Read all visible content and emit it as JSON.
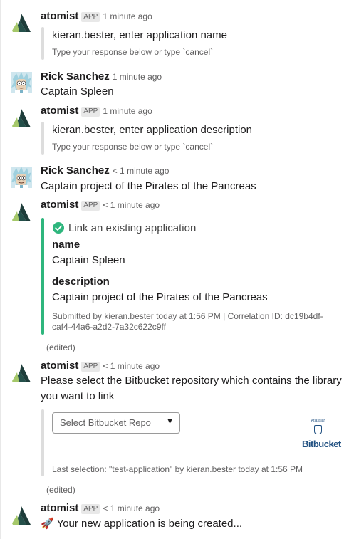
{
  "messages": [
    {
      "sender": "atomist",
      "badge": "APP",
      "time": "1 minute ago",
      "attachment": {
        "title": "kieran.bester, enter application name",
        "footer": "Type your response below or type `cancel`"
      }
    },
    {
      "sender": "Rick Sanchez",
      "time": "1 minute ago",
      "text": "Captain Spleen"
    },
    {
      "sender": "atomist",
      "badge": "APP",
      "time": "1 minute ago",
      "attachment": {
        "title": "kieran.bester, enter application description",
        "footer": "Type your response below or type `cancel`"
      }
    },
    {
      "sender": "Rick Sanchez",
      "time": "< 1 minute ago",
      "text": "Captain project of the Pirates of the Pancreas"
    },
    {
      "sender": "atomist",
      "badge": "APP",
      "time": "< 1 minute ago",
      "attachment": {
        "title": "Link an existing application",
        "fields": [
          {
            "title": "name",
            "value": "Captain Spleen"
          },
          {
            "title": "description",
            "value": "Captain project of the Pirates of the Pancreas"
          }
        ],
        "footer_line1": "Submitted by kieran.bester today at 1:56 PM | Correlation ID: dc19b4df-",
        "footer_line2": "caf4-44a6-a2d2-7a32c622c9ff"
      },
      "edited": "(edited)"
    },
    {
      "sender": "atomist",
      "badge": "APP",
      "time": "< 1 minute ago",
      "text_line1": "Please select the Bitbucket repository which contains the library",
      "text_line2": "you want to link",
      "attachment": {
        "select_placeholder": "Select Bitbucket Repo",
        "logo_small": "Atlassian",
        "logo_text": "Bitbucket",
        "footer": "Last selection: \"test-application\" by kieran.bester today at 1:56 PM"
      },
      "edited": "(edited)"
    },
    {
      "sender": "atomist",
      "badge": "APP",
      "time": "< 1 minute ago",
      "text": "🚀 Your new application is being created..."
    }
  ],
  "colors": {
    "atomist_dark": "#1e3d3a",
    "atomist_light": "#a5c86a",
    "success_green": "#2eb67d",
    "bitbucket_blue": "#205081"
  },
  "icons": {
    "atomist_avatar": "atomist-logo-icon",
    "rick_avatar": "rick-sanchez-avatar",
    "check": "check-circle-icon",
    "caret": "caret-down-icon"
  }
}
